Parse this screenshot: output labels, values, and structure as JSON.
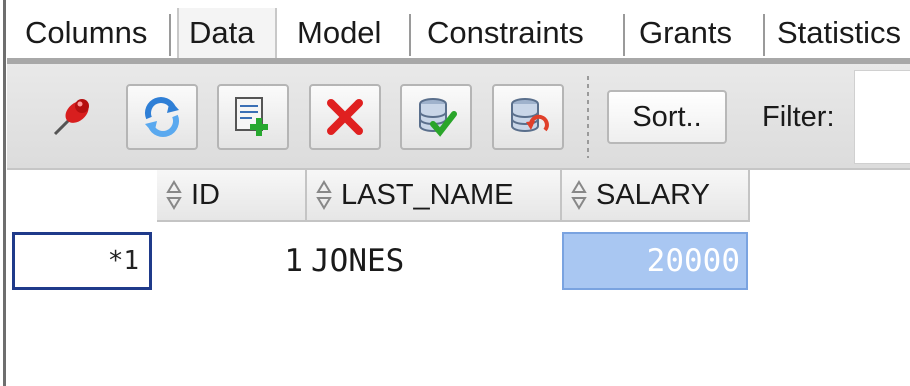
{
  "tabs": [
    {
      "label": "Columns",
      "active": false
    },
    {
      "label": "Data",
      "active": true
    },
    {
      "label": "Model",
      "active": false
    },
    {
      "label": "Constraints",
      "active": false
    },
    {
      "label": "Grants",
      "active": false
    },
    {
      "label": "Statistics",
      "active": false
    }
  ],
  "toolbar": {
    "icons": [
      "pin-icon",
      "refresh-icon",
      "insert-row-icon",
      "delete-row-icon",
      "commit-icon",
      "rollback-icon"
    ],
    "sort_label": "Sort..",
    "filter_label": "Filter:",
    "filter_value": ""
  },
  "grid": {
    "columns": [
      "ID",
      "LAST_NAME",
      "SALARY"
    ],
    "rows": [
      {
        "row_label": "*1",
        "id": "1",
        "last_name": "JONES",
        "salary": "20000"
      }
    ]
  },
  "colors": {
    "selected_cell": "#a9c7f2",
    "row_header_border": "#1f3a8a",
    "delete_red": "#e02020"
  }
}
